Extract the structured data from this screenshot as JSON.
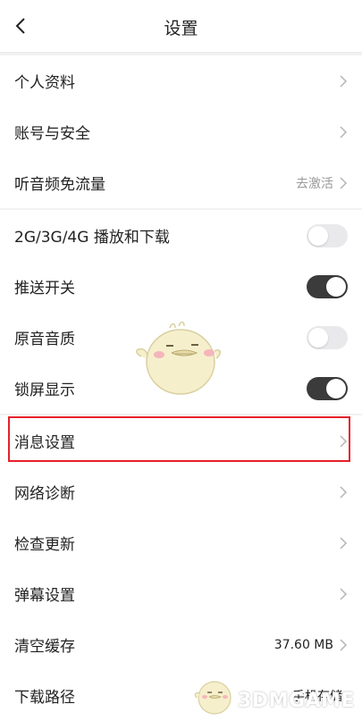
{
  "header": {
    "title": "设置",
    "back_icon": "chevron-left-icon"
  },
  "settings": {
    "profile": "个人资料",
    "account_security": "账号与安全",
    "free_data": {
      "label": "听音频免流量",
      "value": "去激活"
    },
    "mobile_play": {
      "label": "2G/3G/4G 播放和下载",
      "enabled": false
    },
    "push": {
      "label": "推送开关",
      "enabled": true
    },
    "original_quality": {
      "label": "原音音质",
      "enabled": false
    },
    "lockscreen": {
      "label": "锁屏显示",
      "enabled": true
    },
    "message_settings": "消息设置",
    "network_diag": "网络诊断",
    "check_update": "检查更新",
    "danmaku": "弹幕设置",
    "clear_cache": {
      "label": "清空缓存",
      "value": "37.60 MB"
    },
    "download_path": {
      "label": "下载路径",
      "value": "手机存储"
    }
  },
  "colors": {
    "highlight": "#e5212a",
    "toggle_on": "#3b3b3b",
    "toggle_off": "#e9e9eb"
  },
  "watermark": {
    "text": "3DMGAME"
  }
}
